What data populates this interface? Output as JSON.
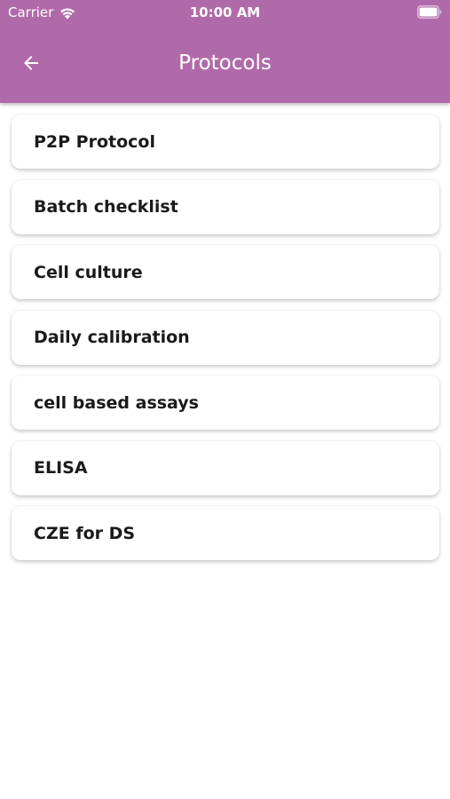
{
  "status_bar": {
    "carrier": "Carrier",
    "time": "10:00 AM"
  },
  "header": {
    "title": "Protocols",
    "back_icon": "arrow-left-icon",
    "background_color": "#b16aa9"
  },
  "protocols": [
    {
      "label": "P2P Protocol"
    },
    {
      "label": "Batch checklist"
    },
    {
      "label": "Cell culture"
    },
    {
      "label": "Daily calibration"
    },
    {
      "label": "cell based assays"
    },
    {
      "label": "ELISA"
    },
    {
      "label": "CZE for DS"
    }
  ]
}
